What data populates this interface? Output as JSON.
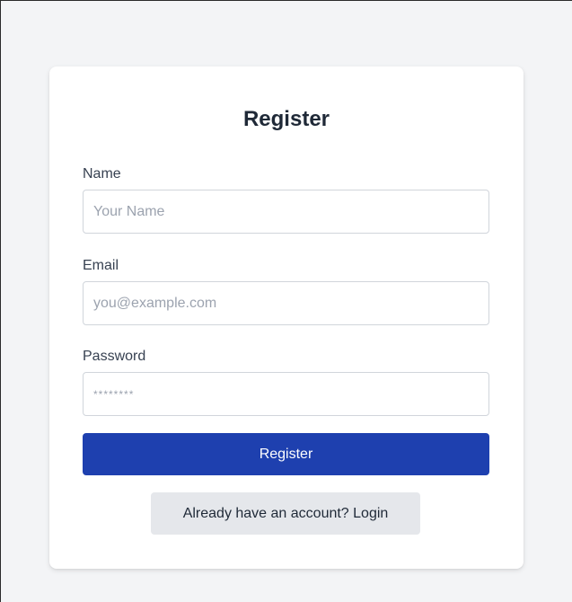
{
  "register_form": {
    "title": "Register",
    "name": {
      "label": "Name",
      "placeholder": "Your Name"
    },
    "email": {
      "label": "Email",
      "placeholder": "you@example.com"
    },
    "password": {
      "label": "Password",
      "placeholder": "********"
    },
    "submit_label": "Register",
    "login_link_label": "Already have an account? Login"
  },
  "colors": {
    "page_background": "#f3f4f6",
    "card_background": "#ffffff",
    "primary_button": "#1e40af",
    "secondary_button": "#e5e7eb"
  }
}
